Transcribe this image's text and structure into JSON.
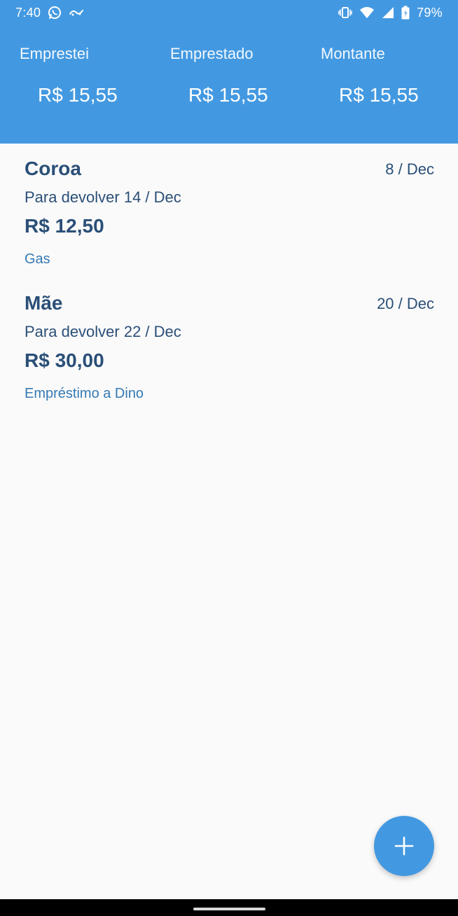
{
  "status_bar": {
    "time": "7:40",
    "battery": "79%",
    "icons_left": [
      "whatsapp-icon",
      "app-notification-icon"
    ],
    "icons_right": [
      "vibrate-icon",
      "wifi-icon",
      "signal-icon",
      "battery-icon"
    ]
  },
  "summary": {
    "lent": {
      "label": "Emprestei",
      "value": "R$ 15,55"
    },
    "borrowed": {
      "label": "Emprestado",
      "value": "R$ 15,55"
    },
    "total": {
      "label": "Montante",
      "value": "R$ 15,55"
    }
  },
  "loans": [
    {
      "name": "Coroa",
      "date": "8 / Dec",
      "return": "Para devolver 14 / Dec",
      "amount": "R$ 12,50",
      "note": "Gas"
    },
    {
      "name": "Mãe",
      "date": "20 / Dec",
      "return": "Para devolver 22 / Dec",
      "amount": "R$ 30,00",
      "note": "Empréstimo a Dino"
    }
  ],
  "fab": {
    "icon": "plus-icon"
  },
  "colors": {
    "primary": "#4399e1",
    "text_dark": "#2a4f77",
    "text_note": "#3479b3",
    "background": "#fafafa"
  }
}
